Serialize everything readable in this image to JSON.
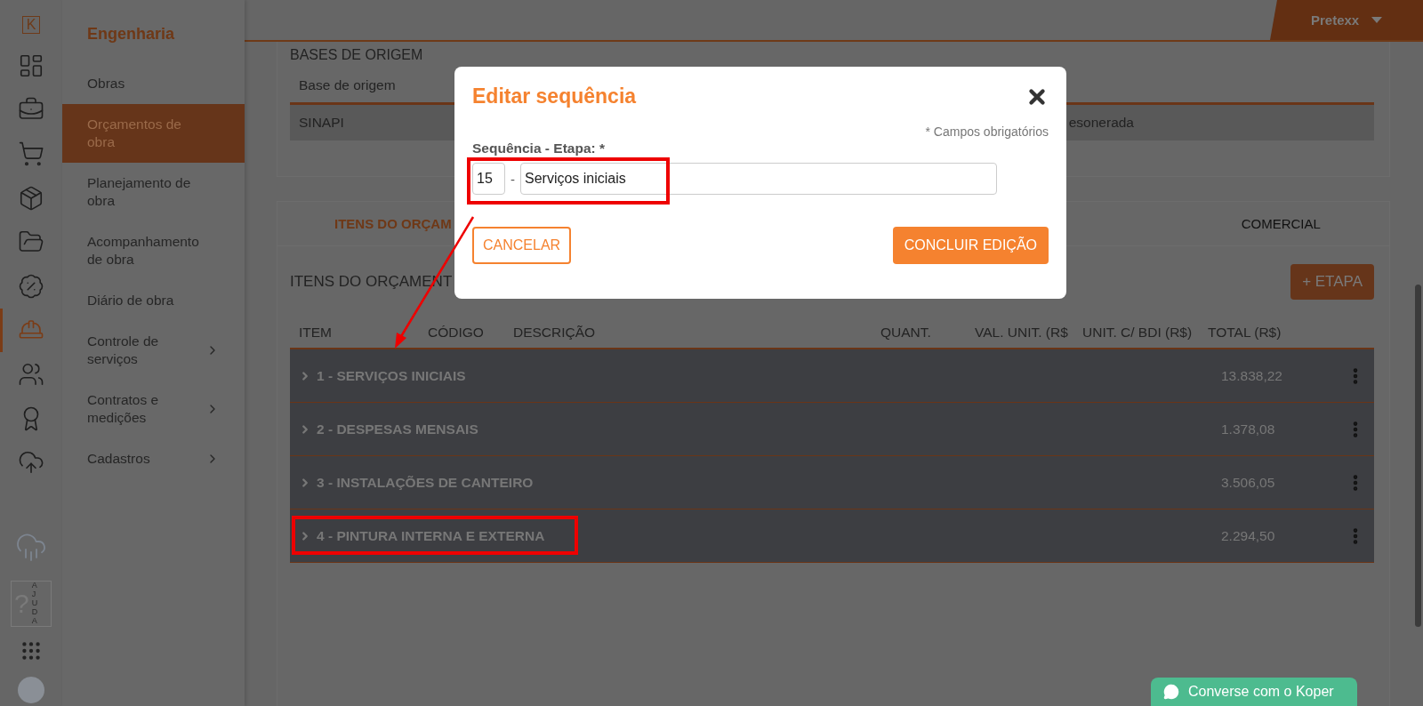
{
  "rail": {
    "logo": "K",
    "items": [
      {
        "kind": "dashboard",
        "selected": false
      },
      {
        "kind": "briefcase",
        "selected": false
      },
      {
        "kind": "cart",
        "selected": false
      },
      {
        "kind": "box",
        "selected": false
      },
      {
        "kind": "folder",
        "selected": false
      },
      {
        "kind": "percent",
        "selected": false
      },
      {
        "kind": "engineer",
        "selected": true
      },
      {
        "kind": "people",
        "selected": false
      },
      {
        "kind": "award",
        "selected": false
      },
      {
        "kind": "upload",
        "selected": false
      }
    ],
    "help": {
      "label": "?",
      "caption": "AJUDA"
    }
  },
  "menu": {
    "title": "Engenharia",
    "items": [
      {
        "label": "Obras",
        "selected": false,
        "submenu": false
      },
      {
        "label": "Orçamentos de obra",
        "selected": true,
        "submenu": false
      },
      {
        "label": "Planejamento de obra",
        "selected": false,
        "submenu": false
      },
      {
        "label": "Acompanhamento de obra",
        "selected": false,
        "submenu": false
      },
      {
        "label": "Diário de obra",
        "selected": false,
        "submenu": false
      },
      {
        "label": "Controle de serviços",
        "selected": false,
        "submenu": true
      },
      {
        "label": "Contratos e medições",
        "selected": false,
        "submenu": true
      },
      {
        "label": "Cadastros",
        "selected": false,
        "submenu": true
      }
    ]
  },
  "header": {
    "user": "Pretexx"
  },
  "origin_bases": {
    "title": "BASES DE ORIGEM",
    "column": "Base de origem",
    "cells": [
      "SINAPI",
      "esonerada"
    ]
  },
  "tabs": [
    {
      "label": "ITENS DO ORÇAM",
      "selected": true
    },
    {
      "label": "COMERCIAL",
      "selected": false
    }
  ],
  "section_title": "ITENS DO ORÇAMENT",
  "add_button": "+ ETAPA",
  "table": {
    "columns": [
      "ITEM",
      "CÓDIGO",
      "DESCRIÇÃO",
      "QUANT.",
      "VAL. UNIT. (R$",
      "UNIT. C/ BDI (R$)",
      "TOTAL (R$)"
    ],
    "rows": [
      {
        "label": "1 - SERVIÇOS INICIAIS",
        "total": "13.838,22",
        "highlighted": false
      },
      {
        "label": "2 - DESPESAS MENSAIS",
        "total": "1.378,08",
        "highlighted": false
      },
      {
        "label": "3 - INSTALAÇÕES DE CANTEIRO",
        "total": "3.506,05",
        "highlighted": false
      },
      {
        "label": "4 - PINTURA INTERNA E EXTERNA",
        "total": "2.294,50",
        "highlighted": true
      }
    ]
  },
  "dialog": {
    "title": "Editar sequência",
    "required_note": "* Campos obrigatórios",
    "field_label": "Sequência - Etapa: *",
    "sequence": "15",
    "separator": "-",
    "stage": "Serviços iniciais",
    "highlighted": true,
    "cancel": "CANCELAR",
    "confirm": "CONCLUIR EDIÇÃO"
  },
  "chat": {
    "label": "Converse com o Koper"
  }
}
